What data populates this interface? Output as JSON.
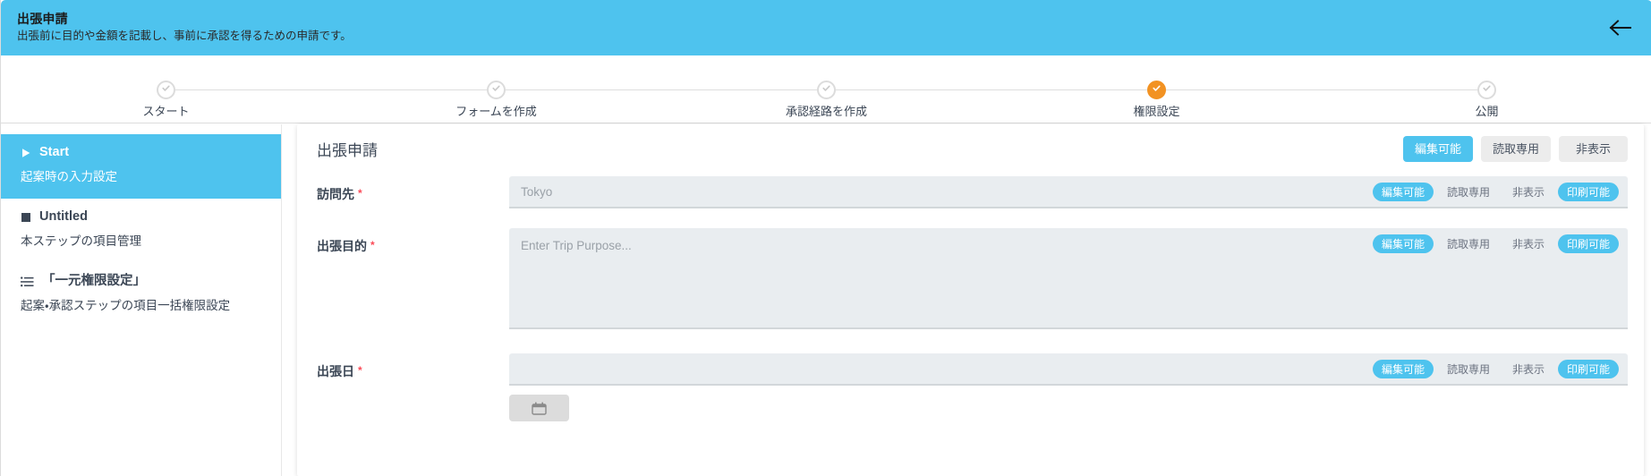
{
  "header": {
    "title": "出張申請",
    "subtitle": "出張前に目的や金額を記載し、事前に承認を得るための申請です。",
    "back_label": "←",
    "bg_color": "#4ec3ee"
  },
  "stepper": {
    "active_color": "#f29222",
    "inactive_color": "#dcdcdc",
    "steps": [
      {
        "label": "スタート",
        "state": "done"
      },
      {
        "label": "フォームを作成",
        "state": "done"
      },
      {
        "label": "承認経路を作成",
        "state": "done"
      },
      {
        "label": "権限設定",
        "state": "active"
      },
      {
        "label": "公開",
        "state": "done"
      }
    ]
  },
  "sidebar": {
    "items": [
      {
        "icon": "play-icon",
        "title": "Start",
        "description": "起案時の入力設定",
        "selected": true
      },
      {
        "icon": "square-icon",
        "title": "Untitled",
        "description": "本ステップの項目管理",
        "selected": false
      },
      {
        "icon": "list-icon",
        "title": "「一元権限設定」",
        "description": "起案・承認ステップの項目一括権限設定",
        "selected": false
      }
    ]
  },
  "main": {
    "card_title": "出張申請",
    "accent_color": "#4ec3ee",
    "global_permissions": [
      {
        "label": "編集可能",
        "active": true
      },
      {
        "label": "読取専用",
        "active": false
      },
      {
        "label": "非表示",
        "active": false
      }
    ],
    "fields": [
      {
        "label": "訪問先",
        "required": true,
        "control": "input",
        "value": "",
        "placeholder": "Tokyo",
        "permissions": [
          {
            "label": "編集可能",
            "active": true
          },
          {
            "label": "読取専用",
            "active": false
          },
          {
            "label": "非表示",
            "active": false
          },
          {
            "label": "印刷可能",
            "active": true
          }
        ]
      },
      {
        "label": "出張目的",
        "required": true,
        "control": "textarea",
        "value": "",
        "placeholder": "Enter Trip Purpose...",
        "permissions": [
          {
            "label": "編集可能",
            "active": true
          },
          {
            "label": "読取専用",
            "active": false
          },
          {
            "label": "非表示",
            "active": false
          },
          {
            "label": "印刷可能",
            "active": true
          }
        ]
      },
      {
        "label": "出張日",
        "required": true,
        "control": "input",
        "value": "",
        "placeholder": "",
        "extra_button_icon": "calendar-icon",
        "permissions": [
          {
            "label": "編集可能",
            "active": true
          },
          {
            "label": "読取専用",
            "active": false
          },
          {
            "label": "非表示",
            "active": false
          },
          {
            "label": "印刷可能",
            "active": true
          }
        ]
      }
    ]
  }
}
